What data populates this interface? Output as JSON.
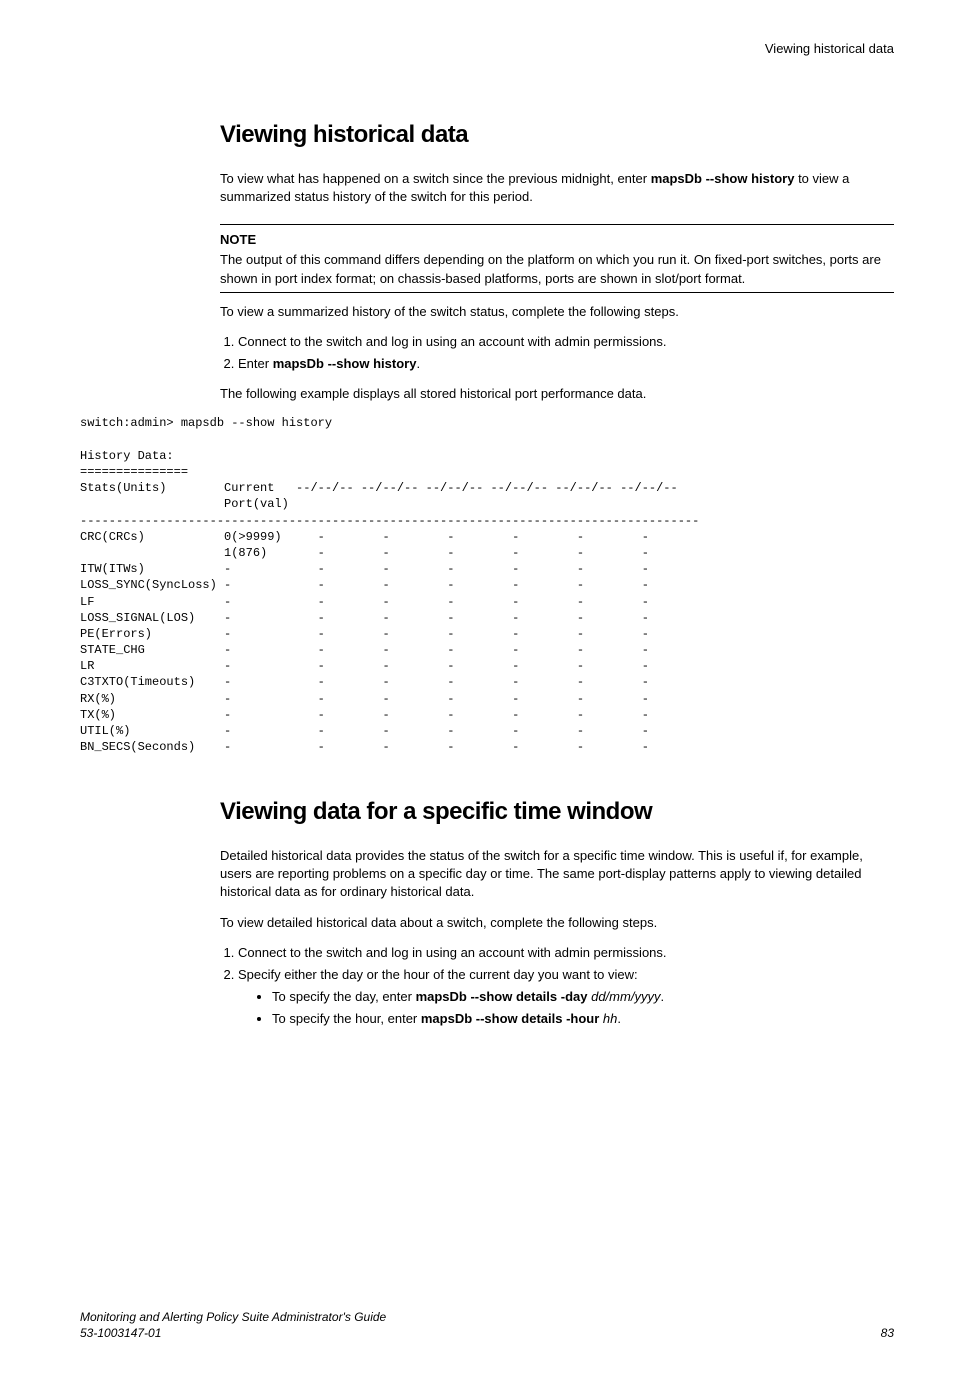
{
  "header": {
    "running_head": "Viewing historical data"
  },
  "section1": {
    "title": "Viewing historical data",
    "intro_pre": "To view what has happened on a switch since the previous midnight, enter ",
    "intro_cmd": "mapsDb --show history",
    "intro_post": " to view a summarized status history of the switch for this period.",
    "note_label": "NOTE",
    "note_body": "The output of this command differs depending on the platform on which you run it. On fixed-port switches, ports are shown in port index format; on chassis-based platforms, ports are shown in slot/port format.",
    "steps_intro": "To view a summarized history of the switch status, complete the following steps.",
    "step1": "Connect to the switch and log in using an account with admin permissions.",
    "step2_pre": "Enter ",
    "step2_cmd": "mapsDb --show history",
    "step2_post": ".",
    "example_lead": "The following example displays all stored historical port performance data."
  },
  "terminal": "switch:admin> mapsdb --show history\n\nHistory Data:\n===============\nStats(Units)        Current   --/--/-- --/--/-- --/--/-- --/--/-- --/--/-- --/--/--\n                    Port(val)\n--------------------------------------------------------------------------------------\nCRC(CRCs)           0(>9999)     -        -        -        -        -        -\n                    1(876)       -        -        -        -        -        -\nITW(ITWs)           -            -        -        -        -        -        -\nLOSS_SYNC(SyncLoss) -            -        -        -        -        -        -\nLF                  -            -        -        -        -        -        -\nLOSS_SIGNAL(LOS)    -            -        -        -        -        -        -\nPE(Errors)          -            -        -        -        -        -        -\nSTATE_CHG           -            -        -        -        -        -        -\nLR                  -            -        -        -        -        -        -\nC3TXTO(Timeouts)    -            -        -        -        -        -        -\nRX(%)               -            -        -        -        -        -        -\nTX(%)               -            -        -        -        -        -        -\nUTIL(%)             -            -        -        -        -        -        -\nBN_SECS(Seconds)    -            -        -        -        -        -        -",
  "section2": {
    "title": "Viewing data for a specific time window",
    "intro": "Detailed historical data provides the status of the switch for a specific time window. This is useful if, for example, users are reporting problems on a specific day or time. The same port-display patterns apply to viewing detailed historical data as for ordinary historical data.",
    "steps_intro": "To view detailed historical data about a switch, complete the following steps.",
    "step1": "Connect to the switch and log in using an account with admin permissions.",
    "step2": "Specify either the day or the hour of the current day you want to view:",
    "bullet1_pre": "To specify the day, enter ",
    "bullet1_cmd": "mapsDb --show details -day",
    "bullet1_arg": " dd/mm/yyyy",
    "bullet1_post": ".",
    "bullet2_pre": "To specify the hour, enter ",
    "bullet2_cmd": "mapsDb --show details -hour",
    "bullet2_arg": " hh",
    "bullet2_post": "."
  },
  "footer": {
    "book": "Monitoring and Alerting Policy Suite Administrator's Guide",
    "docnum": "53-1003147-01",
    "page": "83"
  }
}
